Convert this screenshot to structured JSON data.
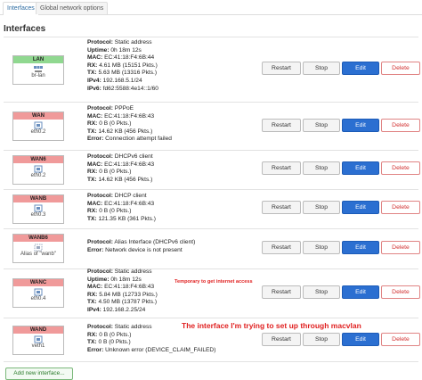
{
  "tabs": [
    "Interfaces",
    "Global network options"
  ],
  "section_title": "Interfaces",
  "labels": {
    "protocol": "Protocol:",
    "uptime": "Uptime:",
    "mac": "MAC:",
    "rx": "RX:",
    "tx": "TX:",
    "ipv4": "IPv4:",
    "ipv6": "IPv6:",
    "error": "Error:"
  },
  "buttons": {
    "restart": "Restart",
    "stop": "Stop",
    "edit": "Edit",
    "delete": "Delete"
  },
  "colors": {
    "lan": "#90d890",
    "wan": "#f09a9a",
    "edit": "#2b6fd1"
  },
  "interfaces": [
    {
      "name": "LAN",
      "device": "br-lan",
      "icon": "bridge-icon",
      "protocol": "Static address",
      "uptime": "0h 18m 12s",
      "mac": "EC:41:18:F4:6B:44",
      "rx": "4.61 MB (15151 Pkts.)",
      "tx": "5.63 MB (13316 Pkts.)",
      "ipv4": "192.168.5.1/24",
      "ipv6": "fd62:5588:4e14::1/60"
    },
    {
      "name": "WAN",
      "device": "eth0.2",
      "icon": "ethernet-port-icon",
      "protocol": "PPPoE",
      "mac": "EC:41:18:F4:6B:43",
      "rx": "0 B (0 Pkts.)",
      "tx": "14.62 KB (456 Pkts.)",
      "error": "Connection attempt failed"
    },
    {
      "name": "WAN6",
      "device": "eth0.2",
      "icon": "ethernet-port-icon",
      "protocol": "DHCPv6 client",
      "mac": "EC:41:18:F4:6B:43",
      "rx": "0 B (0 Pkts.)",
      "tx": "14.62 KB (456 Pkts.)"
    },
    {
      "name": "WANB",
      "device": "eth0.3",
      "icon": "ethernet-port-icon",
      "protocol": "DHCP client",
      "mac": "EC:41:18:F4:6B:43",
      "rx": "0 B (0 Pkts.)",
      "tx": "121.35 KB (361 Pkts.)"
    },
    {
      "name": "WANB6",
      "device": "Alias of \"wanb\"",
      "icon": "alias-icon",
      "protocol": "Alias Interface (DHCPv6 client)",
      "error": "Network device is not present"
    },
    {
      "name": "WANC",
      "device": "eth0.4",
      "icon": "ethernet-port-icon",
      "protocol": "Static address",
      "uptime": "0h 18m 12s",
      "mac": "EC:41:18:F4:6B:43",
      "rx": "5.84 MB (12733 Pkts.)",
      "tx": "4.50 MB (13787 Pkts.)",
      "ipv4": "192.168.2.25/24"
    },
    {
      "name": "WAND",
      "device": "veth1",
      "icon": "ethernet-port-icon",
      "protocol": "Static address",
      "rx": "0 B (0 Pkts.)",
      "tx": "0 B (0 Pkts.)",
      "error": "Unknown error (DEVICE_CLAIM_FAILED)"
    }
  ],
  "annotations": {
    "wanc_note": "Temporary to get internet access",
    "wand_note": "The interface I'm trying to set up through macvlan"
  },
  "add_button": "Add new interface..."
}
